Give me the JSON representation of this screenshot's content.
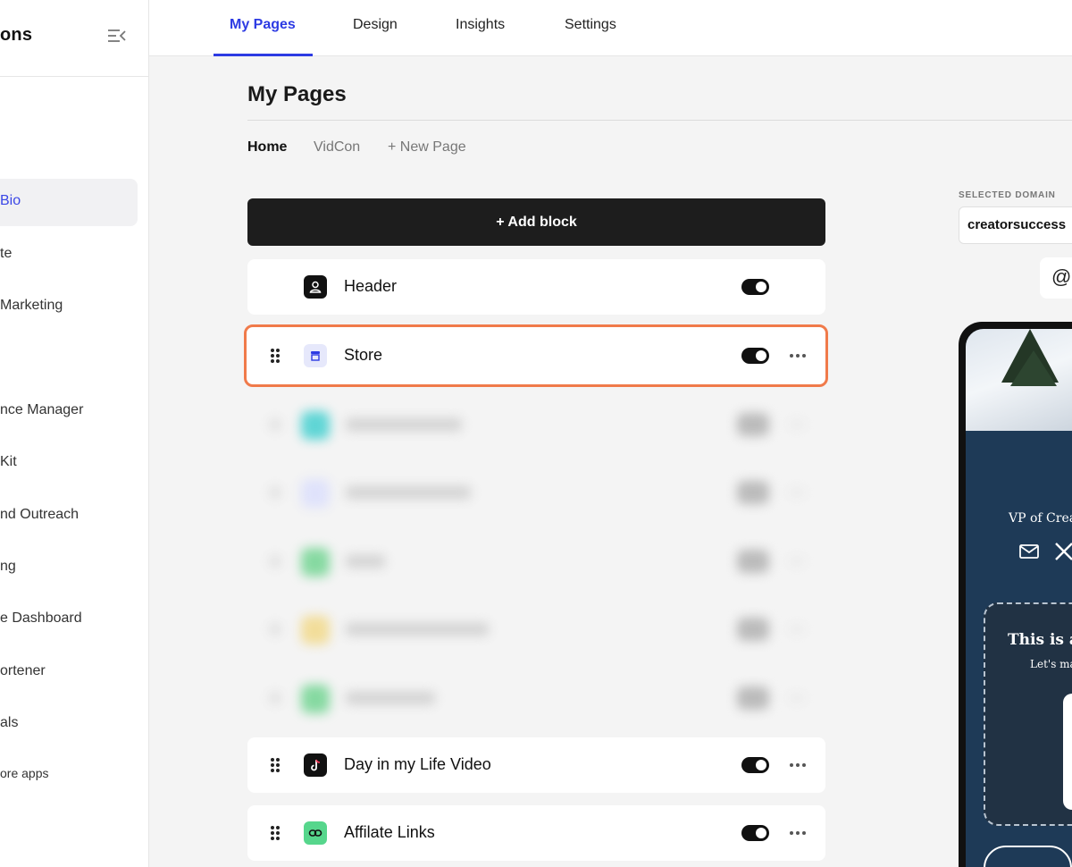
{
  "sidebar": {
    "brand": "ons",
    "items": [
      {
        "label": "Bio",
        "active": true
      },
      {
        "label": "te"
      },
      {
        "label": "Marketing"
      },
      {
        "label": "nce Manager"
      },
      {
        "label": "Kit"
      },
      {
        "label": "nd Outreach"
      },
      {
        "label": "ng"
      },
      {
        "label": "e Dashboard"
      },
      {
        "label": "ortener"
      },
      {
        "label": "als"
      },
      {
        "label": "ore apps"
      }
    ]
  },
  "topnav": {
    "tabs": [
      {
        "label": "My Pages",
        "active": true
      },
      {
        "label": "Design"
      },
      {
        "label": "Insights"
      },
      {
        "label": "Settings"
      }
    ]
  },
  "main": {
    "title": "My Pages",
    "subtabs": [
      {
        "label": "Home",
        "active": true
      },
      {
        "label": "VidCon"
      },
      {
        "label": "+ New Page"
      }
    ],
    "add_block_label": "+ Add block",
    "blocks": [
      {
        "label": "Header",
        "icon": "user-icon",
        "enabled": true
      },
      {
        "label": "Store",
        "icon": "store-icon",
        "enabled": true,
        "highlighted": true
      },
      {
        "label": "Day in my Life Video",
        "icon": "tiktok-icon",
        "enabled": true
      },
      {
        "label": "Affilate Links",
        "icon": "link-icon",
        "enabled": true
      }
    ]
  },
  "preview": {
    "domain_label": "SELECTED DOMAIN",
    "domain_value": "creatorsuccess",
    "at_symbol": "@",
    "bio_text": "VP of Crea",
    "card_title": "This is a",
    "card_subtitle": "Let's ma"
  },
  "colors": {
    "accent": "#2d3be3",
    "highlight_border": "#f07a4a",
    "preview_bg": "#1e3a57"
  }
}
